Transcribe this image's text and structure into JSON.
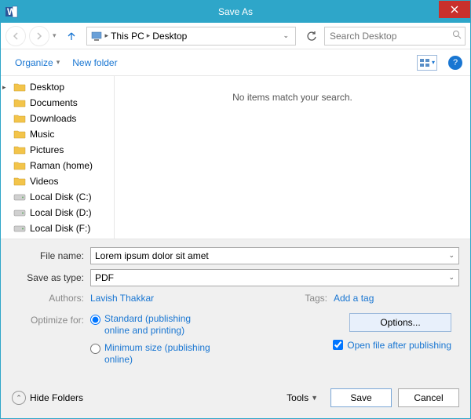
{
  "window": {
    "title": "Save As"
  },
  "nav": {
    "breadcrumb": {
      "root": "This PC",
      "leaf": "Desktop"
    },
    "search_placeholder": "Search Desktop"
  },
  "toolbar": {
    "organize": "Organize",
    "newfolder": "New folder"
  },
  "tree": {
    "items": [
      {
        "label": "Desktop",
        "icon": "folder",
        "selected": true
      },
      {
        "label": "Documents",
        "icon": "folder"
      },
      {
        "label": "Downloads",
        "icon": "folder"
      },
      {
        "label": "Music",
        "icon": "folder"
      },
      {
        "label": "Pictures",
        "icon": "folder"
      },
      {
        "label": "Raman (home)",
        "icon": "folder"
      },
      {
        "label": "Videos",
        "icon": "folder"
      },
      {
        "label": "Local Disk (C:)",
        "icon": "disk"
      },
      {
        "label": "Local Disk (D:)",
        "icon": "disk"
      },
      {
        "label": "Local Disk (F:)",
        "icon": "disk"
      }
    ]
  },
  "content": {
    "empty": "No items match your search."
  },
  "form": {
    "filename_label": "File name:",
    "filename_value": "Lorem ipsum dolor sit amet",
    "saveas_label": "Save as type:",
    "saveas_value": "PDF",
    "authors_label": "Authors:",
    "authors_value": "Lavish Thakkar",
    "tags_label": "Tags:",
    "tags_value": "Add a tag",
    "optimize_label": "Optimize for:",
    "radio_standard": "Standard (publishing online and printing)",
    "radio_min": "Minimum size (publishing online)",
    "options_btn": "Options...",
    "openafter": "Open file after publishing"
  },
  "footer": {
    "hide": "Hide Folders",
    "tools": "Tools",
    "save": "Save",
    "cancel": "Cancel"
  }
}
